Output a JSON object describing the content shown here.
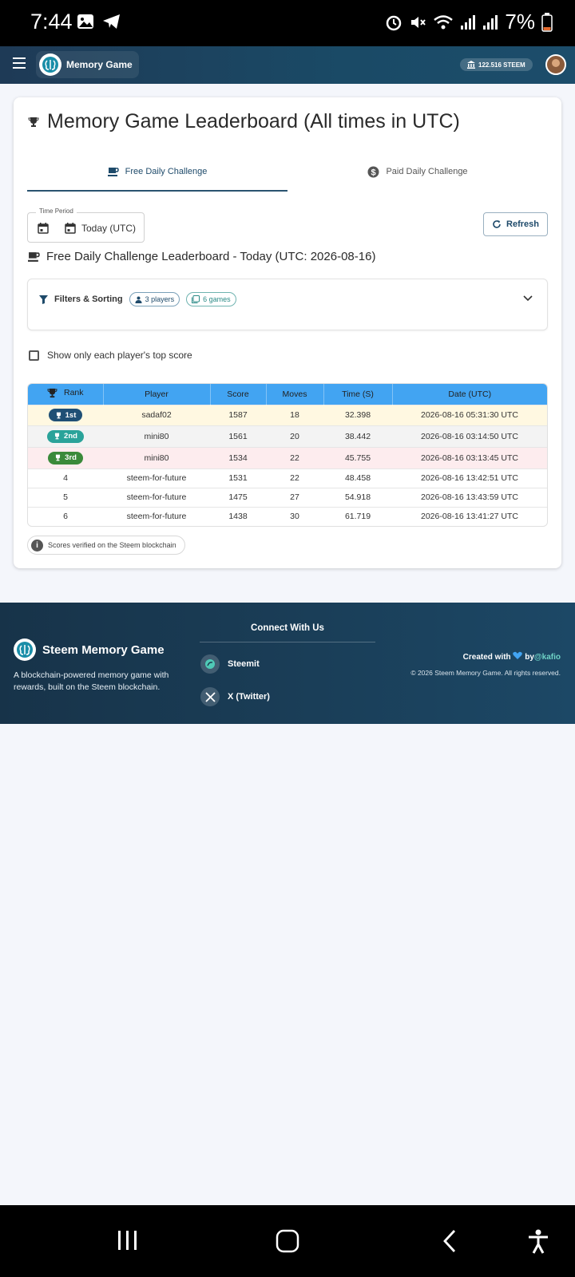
{
  "status_bar": {
    "time": "7:44",
    "battery": "7%",
    "icons": [
      "image-icon",
      "telegram-icon",
      "alarm-icon",
      "mute-icon",
      "wifi-icon",
      "signal-icon",
      "signal-icon",
      "battery-icon"
    ]
  },
  "app_bar": {
    "title": "Memory Game",
    "balance": "122.516 STEEM"
  },
  "page": {
    "title": "Memory Game Leaderboard (All times in UTC)"
  },
  "tabs": [
    {
      "label": "Free Daily Challenge",
      "active": true
    },
    {
      "label": "Paid Daily Challenge",
      "active": false
    }
  ],
  "time_period": {
    "label": "Time Period",
    "value": "Today (UTC)"
  },
  "refresh_label": "Refresh",
  "leaderboard_title": "Free Daily Challenge Leaderboard - Today (UTC: 2026-08-16)",
  "filters": {
    "label": "Filters & Sorting",
    "players_chip": "3 players",
    "games_chip": "6 games"
  },
  "top_score_label": "Show only each player's top score",
  "table": {
    "columns": [
      "Rank",
      "Player",
      "Score",
      "Moves",
      "Time (S)",
      "Date (UTC)"
    ],
    "rows": [
      {
        "rank": "1st",
        "player": "sadaf02",
        "score": "1587",
        "moves": "18",
        "time": "32.398",
        "date": "2026-08-16 05:31:30 UTC"
      },
      {
        "rank": "2nd",
        "player": "mini80",
        "score": "1561",
        "moves": "20",
        "time": "38.442",
        "date": "2026-08-16 03:14:50 UTC"
      },
      {
        "rank": "3rd",
        "player": "mini80",
        "score": "1534",
        "moves": "22",
        "time": "45.755",
        "date": "2026-08-16 03:13:45 UTC"
      },
      {
        "rank": "4",
        "player": "steem-for-future",
        "score": "1531",
        "moves": "22",
        "time": "48.458",
        "date": "2026-08-16 13:42:51 UTC"
      },
      {
        "rank": "5",
        "player": "steem-for-future",
        "score": "1475",
        "moves": "27",
        "time": "54.918",
        "date": "2026-08-16 13:43:59 UTC"
      },
      {
        "rank": "6",
        "player": "steem-for-future",
        "score": "1438",
        "moves": "30",
        "time": "61.719",
        "date": "2026-08-16 13:41:27 UTC"
      }
    ]
  },
  "verified_label": "Scores verified on the Steem blockchain",
  "footer": {
    "brand": "Steem Memory Game",
    "description": "A blockchain-powered memory game with rewards, built on the Steem blockchain.",
    "connect_title": "Connect With Us",
    "links": [
      "Steemit",
      "X (Twitter)"
    ],
    "created_prefix": "Created with",
    "created_by": "by",
    "created_handle": "@kafio",
    "copyright": "© 2026 Steem Memory Game. All rights reserved."
  },
  "colors": {
    "header_bg": "#1e3a56",
    "table_header": "#42a4f2",
    "rank1_bg": "#fff8e1",
    "rank3_bg": "#fdecee",
    "accent_teal": "#2aa39a"
  }
}
